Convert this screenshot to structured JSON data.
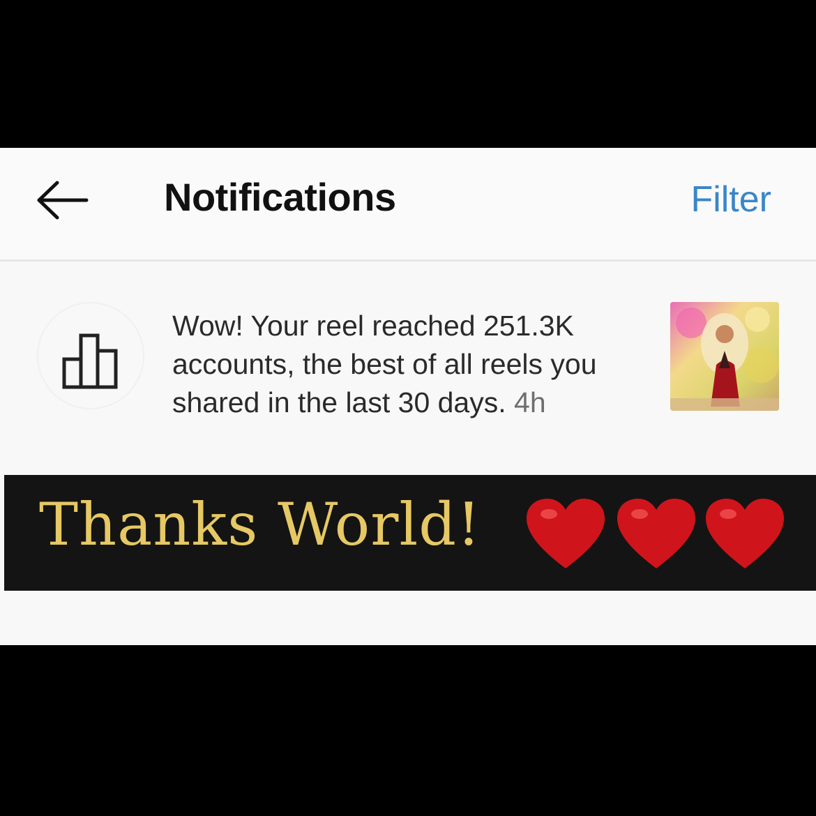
{
  "header": {
    "title": "Notifications",
    "filter_label": "Filter"
  },
  "notification": {
    "line1": "Wow! Your reel reached 251.3K",
    "line2": "accounts, the best of all reels you",
    "line3": "shared in the last 30 days.",
    "time": "4h",
    "icon": "insights-chart-icon"
  },
  "banner": {
    "text": "Thanks World!",
    "icon": "heart-icon",
    "heart_count": 3,
    "text_color": "#e6c864",
    "heart_color": "#d0141b"
  },
  "colors": {
    "accent": "#3a86c8",
    "background": "#f8f8f8",
    "frame": "#000000"
  }
}
